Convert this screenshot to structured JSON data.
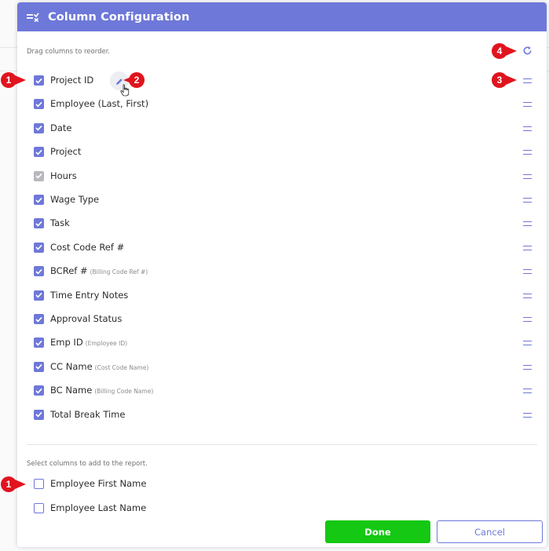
{
  "dialog": {
    "title": "Column Configuration",
    "drag_hint": "Drag columns to reorder.",
    "add_hint": "Select columns to add to the report.",
    "accent_color": "#6e78d9",
    "done_color": "#14c814"
  },
  "selected_columns": [
    {
      "label": "Project ID",
      "sub": "",
      "checked": true,
      "disabled": false
    },
    {
      "label": "Employee (Last, First)",
      "sub": "",
      "checked": true,
      "disabled": false
    },
    {
      "label": "Date",
      "sub": "",
      "checked": true,
      "disabled": false
    },
    {
      "label": "Project",
      "sub": "",
      "checked": true,
      "disabled": false
    },
    {
      "label": "Hours",
      "sub": "",
      "checked": true,
      "disabled": true
    },
    {
      "label": "Wage Type",
      "sub": "",
      "checked": true,
      "disabled": false
    },
    {
      "label": "Task",
      "sub": "",
      "checked": true,
      "disabled": false
    },
    {
      "label": "Cost Code Ref #",
      "sub": "",
      "checked": true,
      "disabled": false
    },
    {
      "label": "BCRef #",
      "sub": "(Billing Code Ref #)",
      "checked": true,
      "disabled": false
    },
    {
      "label": "Time Entry Notes",
      "sub": "",
      "checked": true,
      "disabled": false
    },
    {
      "label": "Approval Status",
      "sub": "",
      "checked": true,
      "disabled": false
    },
    {
      "label": "Emp ID",
      "sub": "(Employee ID)",
      "checked": true,
      "disabled": false
    },
    {
      "label": "CC Name",
      "sub": "(Cost Code Name)",
      "checked": true,
      "disabled": false
    },
    {
      "label": "BC Name",
      "sub": "(Billing Code Name)",
      "checked": true,
      "disabled": false
    },
    {
      "label": "Total Break Time",
      "sub": "",
      "checked": true,
      "disabled": false
    }
  ],
  "available_columns": [
    {
      "label": "Employee First Name",
      "checked": false
    },
    {
      "label": "Employee Last Name",
      "checked": false
    }
  ],
  "buttons": {
    "done": "Done",
    "cancel": "Cancel"
  },
  "callouts": {
    "checkbox": "1",
    "edit": "2",
    "drag": "3",
    "reset": "4",
    "color": "#e0141e"
  },
  "icons": {
    "header": "column-config-icon",
    "reset": "reset-icon",
    "edit": "pencil-icon",
    "drag": "drag-handle-icon",
    "cursor": "hand-cursor-icon"
  }
}
